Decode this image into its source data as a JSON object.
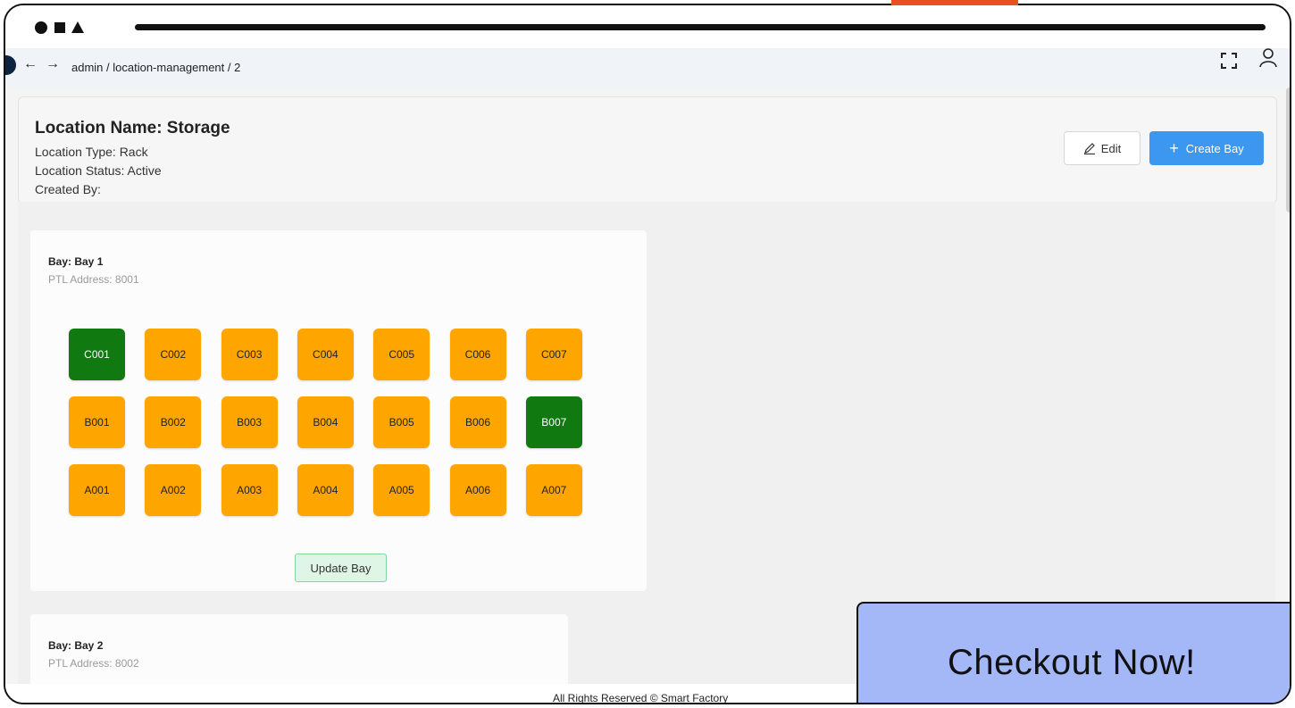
{
  "window": {
    "controls": [
      "circle-icon",
      "square-icon",
      "triangle-icon"
    ]
  },
  "nav": {
    "back_icon": "arrow-left-icon",
    "forward_icon": "arrow-right-icon",
    "breadcrumb": "admin  / location-management  / 2",
    "fullscreen_icon": "fullscreen-icon",
    "user_icon": "user-icon"
  },
  "location": {
    "name": "Location Name: Storage",
    "type": "Location Type: Rack",
    "status": "Location Status: Active",
    "created_by": "Created By:"
  },
  "actions": {
    "edit_label": "Edit",
    "create_label": "Create Bay"
  },
  "bays": [
    {
      "title": "Bay: Bay 1",
      "ptl": "PTL Address: 8001",
      "rows": [
        [
          {
            "code": "C001",
            "state": "active"
          },
          {
            "code": "C002",
            "state": "idle"
          },
          {
            "code": "C003",
            "state": "idle"
          },
          {
            "code": "C004",
            "state": "idle"
          },
          {
            "code": "C005",
            "state": "idle"
          },
          {
            "code": "C006",
            "state": "idle"
          },
          {
            "code": "C007",
            "state": "idle"
          }
        ],
        [
          {
            "code": "B001",
            "state": "idle"
          },
          {
            "code": "B002",
            "state": "idle"
          },
          {
            "code": "B003",
            "state": "idle"
          },
          {
            "code": "B004",
            "state": "idle"
          },
          {
            "code": "B005",
            "state": "idle"
          },
          {
            "code": "B006",
            "state": "idle"
          },
          {
            "code": "B007",
            "state": "active"
          }
        ],
        [
          {
            "code": "A001",
            "state": "idle"
          },
          {
            "code": "A002",
            "state": "idle"
          },
          {
            "code": "A003",
            "state": "idle"
          },
          {
            "code": "A004",
            "state": "idle"
          },
          {
            "code": "A005",
            "state": "idle"
          },
          {
            "code": "A006",
            "state": "idle"
          },
          {
            "code": "A007",
            "state": "idle"
          }
        ]
      ],
      "update_label": "Update Bay"
    },
    {
      "title": "Bay: Bay 2",
      "ptl": "PTL Address: 8002"
    }
  ],
  "colors": {
    "cell_idle": "#ffa500",
    "cell_active": "#107a10",
    "primary": "#3b97f0"
  },
  "footer": {
    "text": "All Rights Reserved © Smart Factory"
  },
  "promo": {
    "label": "Checkout Now!"
  }
}
